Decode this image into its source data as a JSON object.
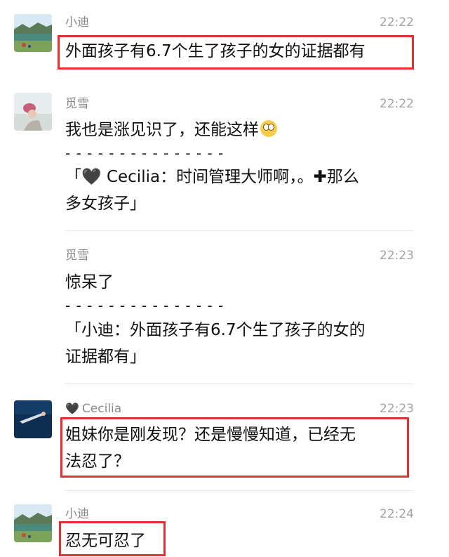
{
  "messages": [
    {
      "sender": "小迪",
      "time": "22:22",
      "avatar_icon": "lake-landscape-avatar",
      "lines": [
        "外面孩子有6.7个生了孩子的女的证据都有"
      ]
    },
    {
      "sender": "觅雪",
      "time": "22:22",
      "avatar_icon": "girl-portrait-avatar",
      "text_main": "我也是涨见识了，还能这样",
      "emoji": "flushed-face-emoji",
      "separator": "- - - - - - - - - - - - - - -",
      "quote_prefix": "「",
      "quote_heart": "🖤",
      "quote_line1_rest": " Cecilia：时间管理大师啊，。",
      "quote_plus": "✚",
      "quote_line1_end": "那么",
      "quote_line2": "多女孩子」"
    },
    {
      "sender": "觅雪",
      "time": "22:23",
      "text_main": "惊呆了",
      "separator": "- - - - - - - - - - - - - - -",
      "quote_line1": "「小迪：外面孩子有6.7个生了孩子的女的",
      "quote_line2": "证据都有」"
    },
    {
      "sender_heart": "🖤",
      "sender": "Cecilia",
      "time": "22:23",
      "avatar_icon": "ocean-diver-avatar",
      "line1": "姐妹你是刚发现？还是慢慢知道，已经无",
      "line2": "法忍了？"
    },
    {
      "sender": "小迪",
      "time": "22:24",
      "avatar_icon": "lake-landscape-avatar",
      "line1": "忍无可忍了"
    }
  ],
  "colors": {
    "highlight_red": "#e33131",
    "name_gray": "#8a8a8a",
    "time_gray": "#a3a3a3",
    "divider": "#e8e8e8"
  }
}
